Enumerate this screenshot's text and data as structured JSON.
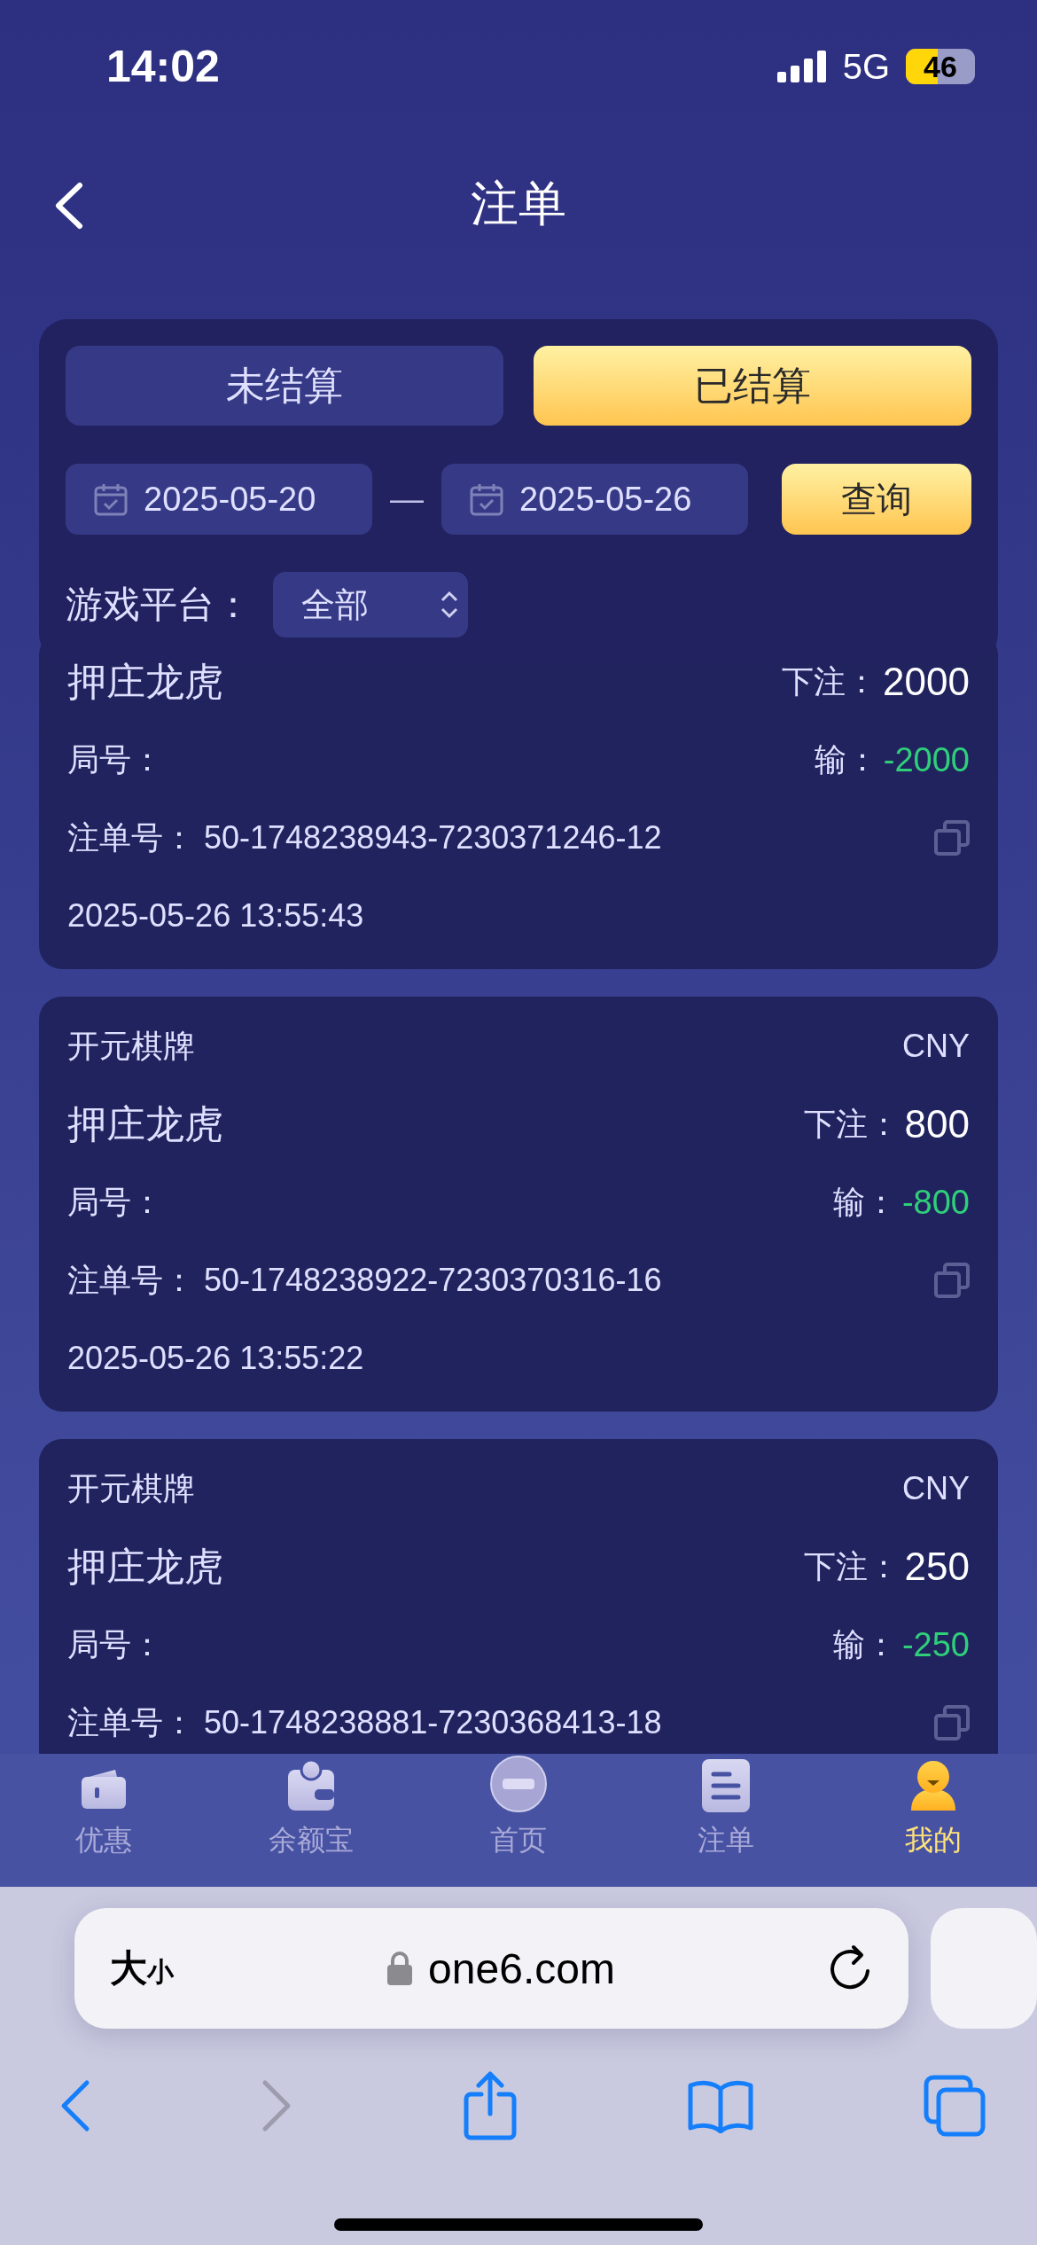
{
  "status_bar": {
    "time": "14:02",
    "network": "5G",
    "battery": "46"
  },
  "header": {
    "title": "注单"
  },
  "filter": {
    "tabs": [
      {
        "label": "未结算",
        "selected": false
      },
      {
        "label": "已结算",
        "selected": true
      }
    ],
    "date_from": "2025-05-20",
    "separator": "—",
    "date_to": "2025-05-26",
    "query_button": "查询",
    "platform_label": "游戏平台：",
    "platform_value": "全部"
  },
  "bets": [
    {
      "game": "押庄龙虎",
      "stake_label": "下注：",
      "stake": "2000",
      "round_label": "局号：",
      "result_label": "输：",
      "result": "-2000",
      "order_label": "注单号：",
      "order_no": "50-1748238943-7230371246-12",
      "time": "2025-05-26 13:55:43"
    },
    {
      "platform": "开元棋牌",
      "currency": "CNY",
      "game": "押庄龙虎",
      "stake_label": "下注：",
      "stake": "800",
      "round_label": "局号：",
      "result_label": "输：",
      "result": "-800",
      "order_label": "注单号：",
      "order_no": "50-1748238922-7230370316-16",
      "time": "2025-05-26 13:55:22"
    },
    {
      "platform": "开元棋牌",
      "currency": "CNY",
      "game": "押庄龙虎",
      "stake_label": "下注：",
      "stake": "250",
      "round_label": "局号：",
      "result_label": "输：",
      "result": "-250",
      "order_label": "注单号：",
      "order_no": "50-1748238881-7230368413-18"
    }
  ],
  "tab_bar": [
    {
      "kind": "coupon",
      "label": "优惠",
      "selected": false
    },
    {
      "kind": "wallet",
      "label": "余额宝",
      "selected": false
    },
    {
      "kind": "home",
      "label": "首页",
      "selected": false
    },
    {
      "kind": "orders",
      "label": "注单",
      "selected": false
    },
    {
      "kind": "profile",
      "label": "我的",
      "selected": true
    }
  ],
  "browser": {
    "text_size_large": "大",
    "text_size_small": "小",
    "url": "one6.com"
  }
}
